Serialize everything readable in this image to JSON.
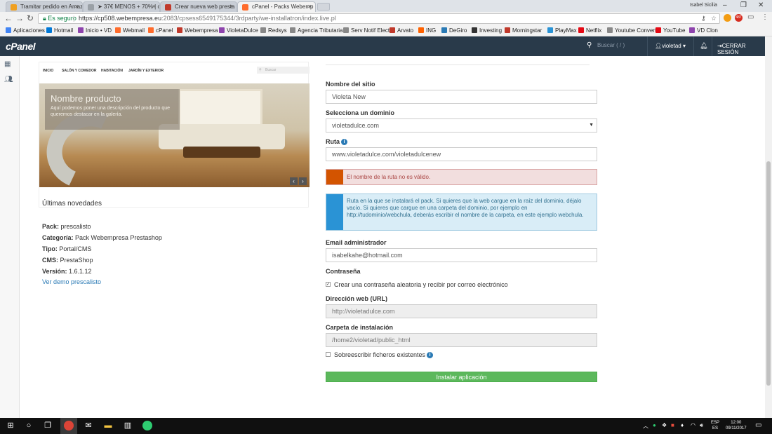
{
  "browser": {
    "tabs": [
      {
        "title": "Tramitar pedido en Amaz",
        "color": "#f0a020"
      },
      {
        "title": "➤ 37€ MENOS + 70% | c",
        "color": "#9aa0a6"
      },
      {
        "title": "Crear nueva web presta",
        "color": "#c0392b"
      },
      {
        "title": "cPanel - Packs Webemp",
        "color": "#ff6c2c"
      }
    ],
    "window_user": "Isabel Sicilia",
    "secure_label": "Es seguro",
    "url_host": "https://cp508.webempresa.eu",
    "url_path": ":2083/cpsess6549175344/3rdparty/we-installatron/index.live.pl",
    "badge_count": "487",
    "bookmarks": [
      {
        "label": "Aplicaciones",
        "color": "#4285f4"
      },
      {
        "label": "Hotmail",
        "color": "#0078d7"
      },
      {
        "label": "Inicio • VD",
        "color": "#8e44ad"
      },
      {
        "label": "Webmail",
        "color": "#ff6c2c"
      },
      {
        "label": "cPanel",
        "color": "#ff6c2c"
      },
      {
        "label": "Webempresa",
        "color": "#c0392b"
      },
      {
        "label": "VioletaDulce",
        "color": "#8e44ad"
      },
      {
        "label": "Redsys",
        "color": "#888888"
      },
      {
        "label": "Agencia Tributaria",
        "color": "#888888"
      },
      {
        "label": "Serv Notif Elect",
        "color": "#888888"
      },
      {
        "label": "Arvato",
        "color": "#c0392b"
      },
      {
        "label": "ING",
        "color": "#ff6200"
      },
      {
        "label": "DeGiro",
        "color": "#2a7ab5"
      },
      {
        "label": "Investing",
        "color": "#333333"
      },
      {
        "label": "Morningstar",
        "color": "#c0392b"
      },
      {
        "label": "PlayMax",
        "color": "#2a93d5"
      },
      {
        "label": "Netflix",
        "color": "#e50914"
      },
      {
        "label": "Youtube Convert",
        "color": "#888888"
      },
      {
        "label": "YouTube",
        "color": "#e50914"
      },
      {
        "label": "VD Clon",
        "color": "#8e44ad"
      }
    ]
  },
  "cpanel": {
    "logo": "cPanel",
    "search_placeholder": "Buscar ( / )",
    "user": "violetad",
    "logout": "CERRAR SESIÓN"
  },
  "preview": {
    "nav": [
      "INICIO",
      "SALÓN Y COMEDOR",
      "HABITACIÓN",
      "JARDÍN Y EXTERIOR"
    ],
    "search_placeholder": "Buscar",
    "caption_title": "Nombre producto",
    "caption_desc": "Aquí podemos poner una descripción del producto que queremos destacar en la galería.",
    "news_title": "Últimas novedades"
  },
  "pack_info": {
    "pack": {
      "label": "Pack:",
      "value": "prescalisto"
    },
    "category": {
      "label": "Categoría:",
      "value": "Pack Webempresa Prestashop"
    },
    "type": {
      "label": "Tipo:",
      "value": "Portal/CMS"
    },
    "cms": {
      "label": "CMS:",
      "value": "PrestaShop"
    },
    "version": {
      "label": "Versión:",
      "value": "1.6.1.12"
    },
    "demo_link": "Ver demo prescalisto"
  },
  "form": {
    "site_name_label": "Nombre del sitio",
    "site_name_value": "Violeta New",
    "domain_label": "Selecciona un dominio",
    "domain_value": "violetadulce.com",
    "path_label": "Ruta",
    "path_value": "www.violetadulce.com/violetadulcenew",
    "error_msg": "El nombre de la ruta no es válido.",
    "info_msg": "Ruta en la que se instalará el pack. Si quieres que la web cargue en la raíz del dominio, déjalo vacío. Si quieres que cargue en una carpeta del dominio, por ejemplo en http://tudominio/webchula, deberás escribir el nombre de la carpeta, en este ejemplo webchula.",
    "email_label": "Email administrador",
    "email_value": "isabelkahe@hotmail.com",
    "password_label": "Contraseña",
    "password_checkbox": "Crear una contraseña aleatoria y recibir por correo electrónico",
    "web_url_label": "Dirección web (URL)",
    "web_url_value": "http://violetadulce.com",
    "folder_label": "Carpeta de instalación",
    "folder_value": "/home2/violetad/public_html",
    "overwrite_checkbox": "Sobreescribir ficheros existentes",
    "install_button": "Instalar aplicación"
  },
  "taskbar": {
    "lang_top": "ESP",
    "lang_bottom": "ES",
    "time": "12:00",
    "date": "09/11/2017"
  }
}
